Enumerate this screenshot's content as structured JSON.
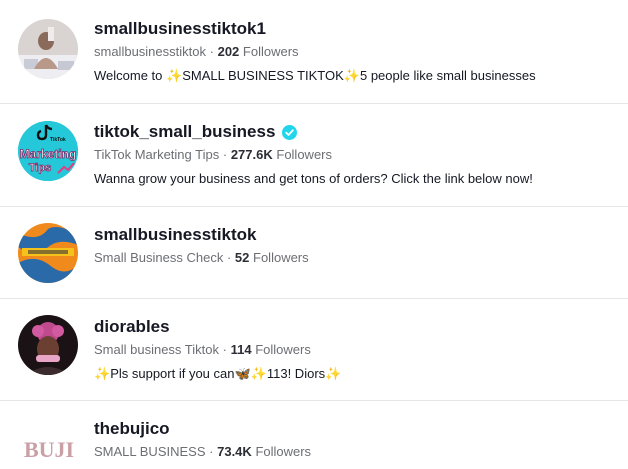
{
  "results": [
    {
      "username": "smallbusinesstiktok1",
      "nickname": "smallbusinesstiktok",
      "followers": "202",
      "followers_label": "Followers",
      "bio_parts": [
        "Welcome to ",
        "✨",
        "SMALL BUSINESS TIKTOK",
        "✨",
        "5 people like small businesses"
      ],
      "avatar_icon": "person-photo-avatar"
    },
    {
      "username": "tiktok_small_business",
      "verified": true,
      "nickname": "TikTok Marketing Tips",
      "followers": "277.6K",
      "followers_label": "Followers",
      "bio": "Wanna grow your business and get tons of orders? Click the link below now!",
      "avatar_text": [
        "TikTok",
        "Marketing",
        "Tips"
      ]
    },
    {
      "username": "smallbusinesstiktok",
      "nickname": "Small Business Check",
      "followers": "52",
      "followers_label": "Followers",
      "avatar_icon": "orange-blue-logo-avatar"
    },
    {
      "username": "diorables",
      "nickname": "Small business Tiktok",
      "followers": "114",
      "followers_label": "Followers",
      "bio_parts": [
        "✨",
        "Pls support if you can",
        "🦋",
        "✨",
        "113! Diors",
        "✨"
      ],
      "avatar_icon": "pink-hair-avatar"
    },
    {
      "username": "thebujico",
      "nickname": "SMALL BUSINESS",
      "followers": "73.4K",
      "followers_label": "Followers",
      "avatar_text": [
        "BUJI"
      ]
    }
  ],
  "separator": "·",
  "colors": {
    "verified": "#20d5ec",
    "divider": "#e6e6e6",
    "meta": "#6d6e74"
  }
}
